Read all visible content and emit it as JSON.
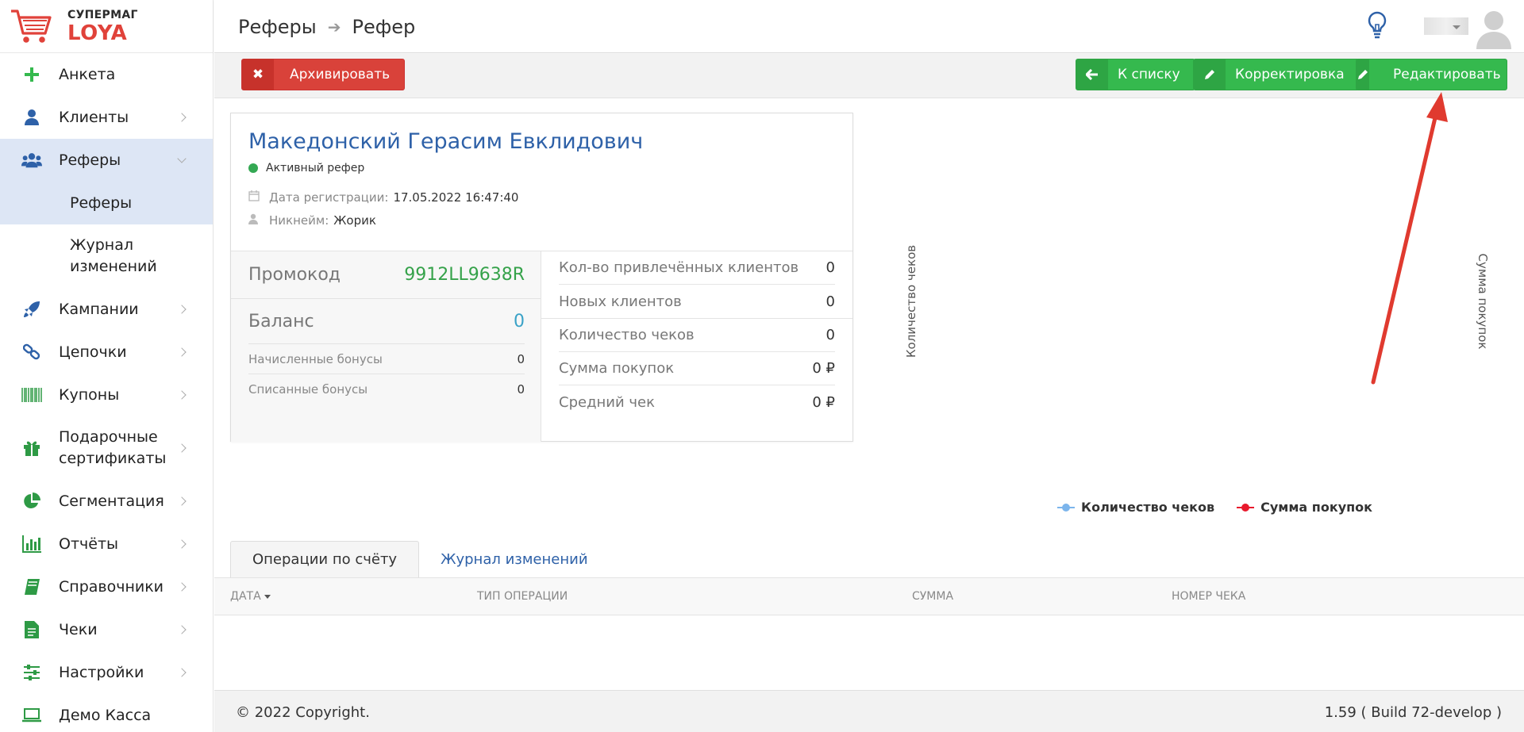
{
  "brand": {
    "line1": "СУПЕРМАГ",
    "line2": "LOYA"
  },
  "sidebar": {
    "items": [
      {
        "label": "Анкета",
        "icon": "plus-icon"
      },
      {
        "label": "Клиенты",
        "icon": "user-icon"
      },
      {
        "label": "Реферы",
        "icon": "users-icon",
        "expanded": true
      },
      {
        "label": "Кампании",
        "icon": "rocket-icon"
      },
      {
        "label": "Цепочки",
        "icon": "link-icon"
      },
      {
        "label": "Купоны",
        "icon": "barcode-icon"
      },
      {
        "label": "Подарочные сертификаты",
        "icon": "gift-icon"
      },
      {
        "label": "Сегментация",
        "icon": "pie-chart-icon"
      },
      {
        "label": "Отчёты",
        "icon": "bar-chart-icon"
      },
      {
        "label": "Справочники",
        "icon": "book-icon"
      },
      {
        "label": "Чеки",
        "icon": "document-icon"
      },
      {
        "label": "Настройки",
        "icon": "sliders-icon"
      },
      {
        "label": "Демо Касса",
        "icon": "laptop-icon"
      }
    ],
    "subitems": [
      {
        "label": "Реферы",
        "active": true
      },
      {
        "label": "Журнал изменений"
      }
    ]
  },
  "header": {
    "breadcrumb": [
      "Реферы",
      "Рефер"
    ]
  },
  "toolbar": {
    "archive_label": "Архивировать",
    "back_label": "К списку",
    "correct_label": "Корректировка",
    "edit_label": "Редактировать"
  },
  "profile": {
    "name": "Македонский Герасим Евклидович",
    "status": "Активный рефер",
    "reg_label": "Дата регистрации:",
    "reg_value": "17.05.2022 16:47:40",
    "nick_label": "Никнейм:",
    "nick_value": "Жорик",
    "promo_label": "Промокод",
    "promo_value": "9912LL9638R",
    "balance_label": "Баланс",
    "balance_value": "0",
    "accrued_label": "Начисленные бонусы",
    "accrued_value": "0",
    "spent_label": "Списанные бонусы",
    "spent_value": "0",
    "stats": [
      {
        "label": "Кол-во привлечённых клиентов",
        "value": "0"
      },
      {
        "label": "Новых клиентов",
        "value": "0"
      },
      {
        "label": "Количество чеков",
        "value": "0"
      },
      {
        "label": "Сумма покупок",
        "value": "0 ₽"
      },
      {
        "label": "Средний чек",
        "value": "0 ₽"
      }
    ]
  },
  "chart_data": {
    "type": "line",
    "ylabel_left": "Количество чеков",
    "ylabel_right": "Сумма покупок",
    "series": [
      {
        "name": "Количество чеков",
        "color": "#7cb5ec",
        "values": []
      },
      {
        "name": "Сумма покупок",
        "color": "#e8192c",
        "values": []
      }
    ],
    "legend": "bottom-center"
  },
  "tabs": [
    {
      "label": "Операции по счёту",
      "active": true
    },
    {
      "label": "Журнал изменений",
      "active": false
    }
  ],
  "table": {
    "columns": [
      "ДАТА",
      "ТИП ОПЕРАЦИИ",
      "СУММА",
      "НОМЕР ЧЕКА"
    ],
    "rows": []
  },
  "footer": {
    "copyright": "© 2022 Copyright.",
    "version": "1.59 ( Build 72-develop )"
  },
  "colors": {
    "accent_blue": "#2e61a8",
    "green": "#35b94e",
    "red": "#d9423a",
    "sidebar_active": "#dde6f5"
  }
}
